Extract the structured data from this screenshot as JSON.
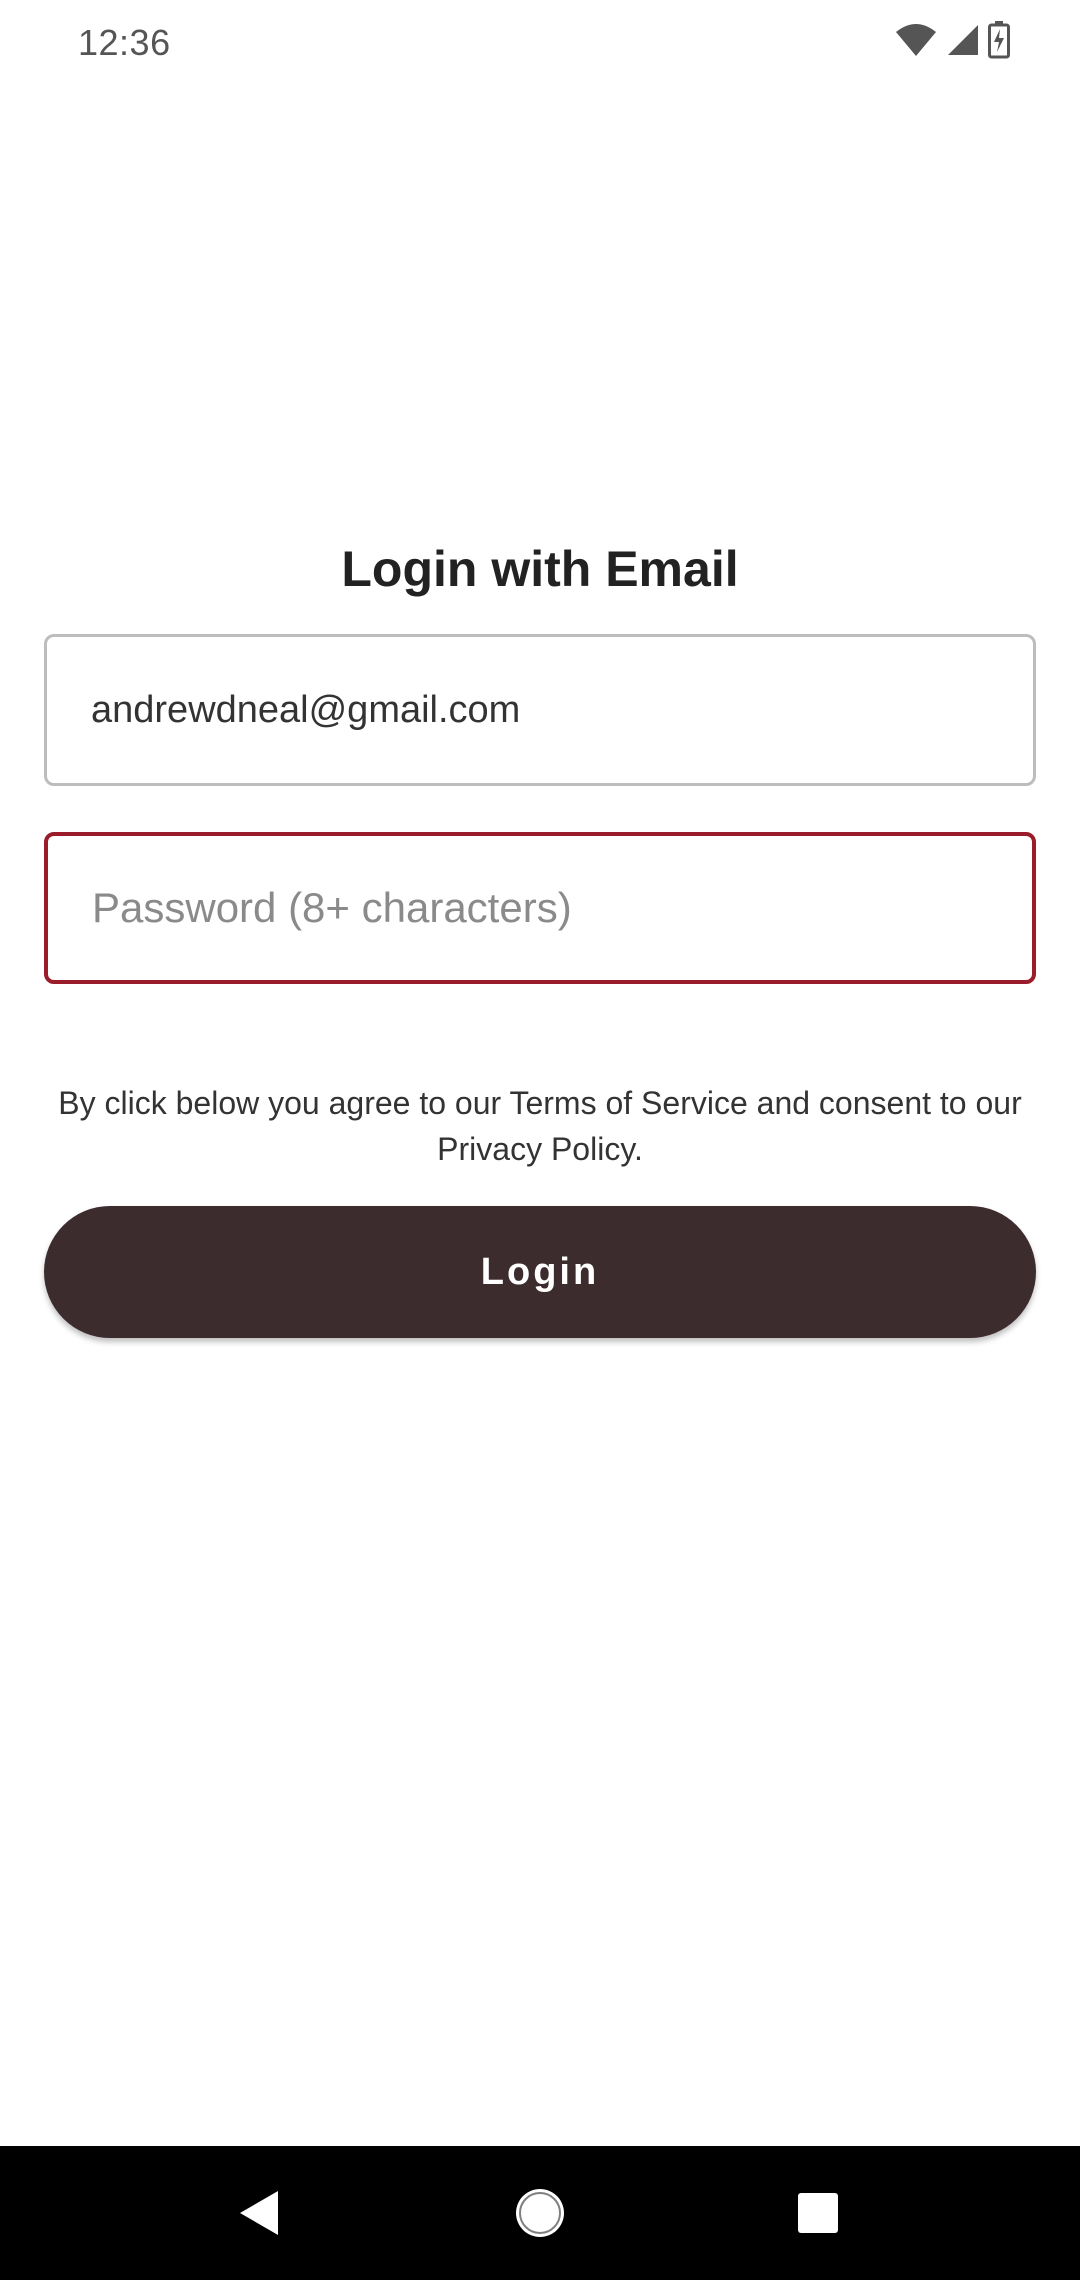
{
  "status_bar": {
    "time": "12:36",
    "icons": [
      "wifi-icon",
      "cell-signal-icon",
      "battery-charging-icon"
    ]
  },
  "login": {
    "title": "Login with Email",
    "email_value": "andrewdneal@gmail.com",
    "password_placeholder": "Password (8+ characters)",
    "terms_text": "By click below you agree to our Terms of Service and consent to our Privacy Policy.",
    "button_label": "Login"
  },
  "colors": {
    "button_bg": "#3d2c2e",
    "error_border": "#9b1c2b",
    "field_border": "#bdbdbd"
  },
  "nav_bar": {
    "buttons": [
      "back-icon",
      "home-icon",
      "recents-icon"
    ]
  }
}
